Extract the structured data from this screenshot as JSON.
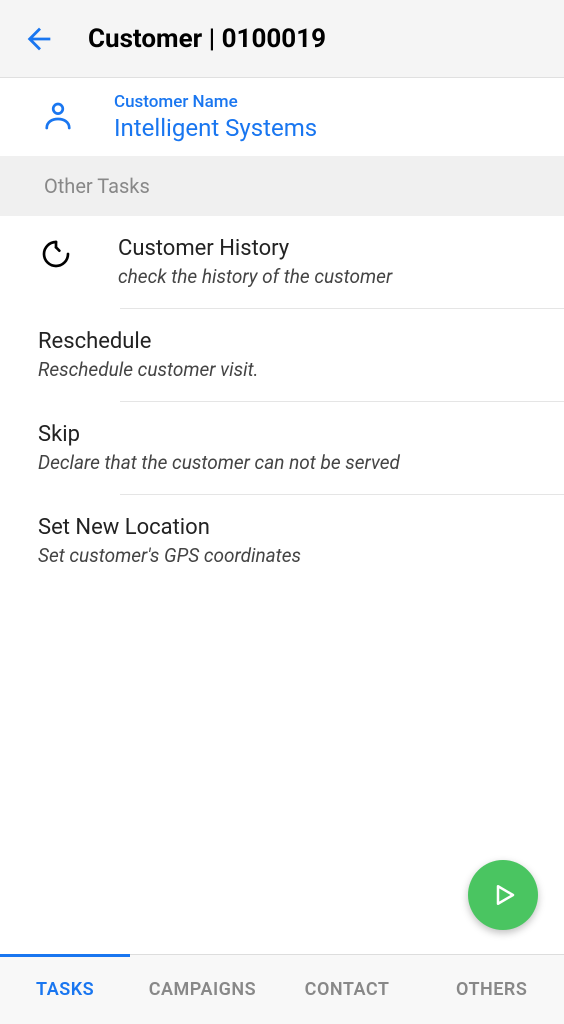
{
  "header": {
    "title": "Customer | 0100019"
  },
  "customer": {
    "label": "Customer Name",
    "name": "Intelligent Systems"
  },
  "section": {
    "title": "Other Tasks"
  },
  "tasks": [
    {
      "title": "Customer History",
      "desc": "check the history of the customer"
    },
    {
      "title": "Reschedule",
      "desc": "Reschedule customer visit."
    },
    {
      "title": "Skip",
      "desc": "Declare that the customer can not be served"
    },
    {
      "title": "Set New Location",
      "desc": "Set customer's GPS coordinates"
    }
  ],
  "nav": {
    "tabs": [
      "TASKS",
      "CAMPAIGNS",
      "CONTACT",
      "OTHERS"
    ],
    "active": 0
  },
  "colors": {
    "accent": "#1976f0",
    "fab": "#4ac561"
  }
}
